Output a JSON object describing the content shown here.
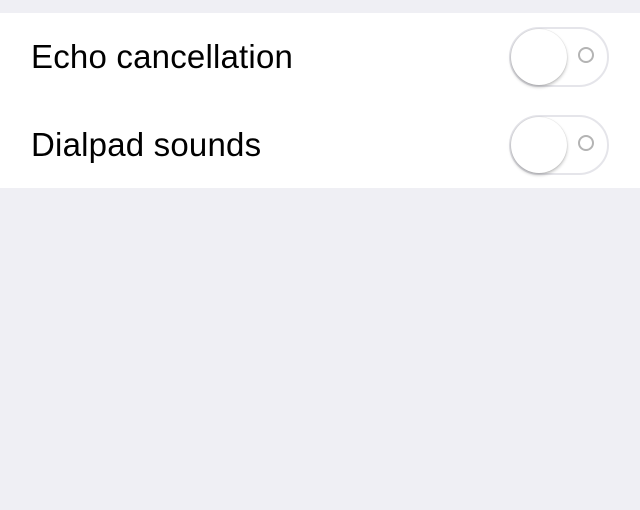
{
  "settings": {
    "rows": [
      {
        "label": "Echo cancellation",
        "toggle_on": false
      },
      {
        "label": "Dialpad sounds",
        "toggle_on": false
      }
    ]
  },
  "colors": {
    "background": "#efeff4",
    "group_background": "#ffffff",
    "toggle_border": "#e5e5ea",
    "off_indicator": "#b4b4b4"
  }
}
